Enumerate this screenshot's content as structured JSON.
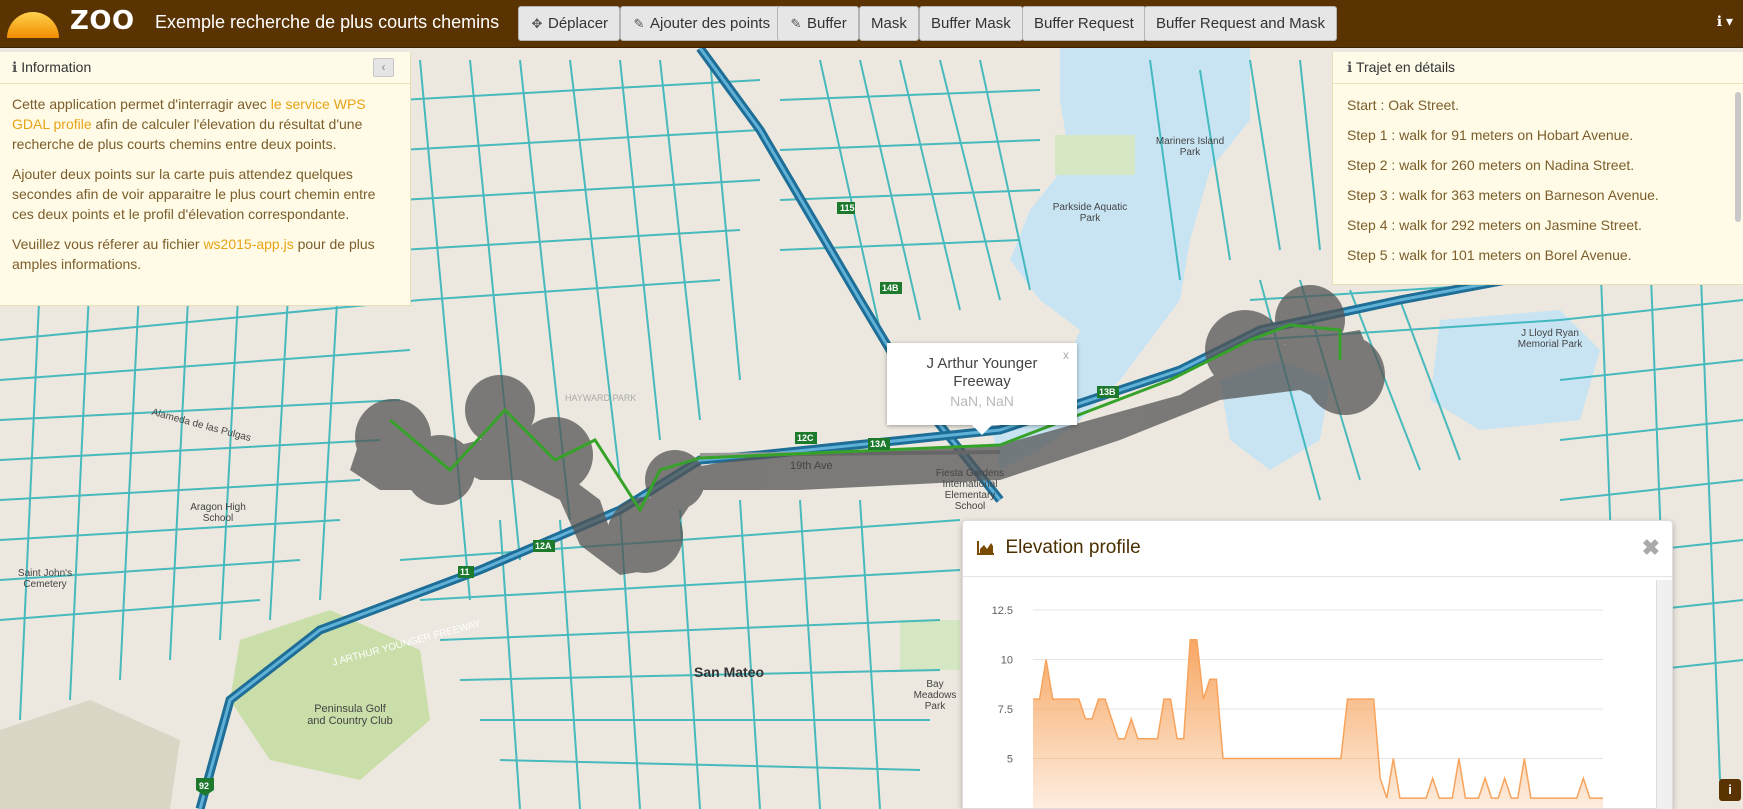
{
  "navbar": {
    "brand": "ZOO",
    "title": "Exemple recherche de plus courts chemins",
    "buttons": [
      {
        "icon": "move-icon",
        "glyph": "✥",
        "label": "Déplacer"
      },
      {
        "icon": "pencil-icon",
        "glyph": "✎",
        "label": "Ajouter des points"
      },
      {
        "icon": "pencil-icon",
        "glyph": "✎",
        "label": "Buffer"
      },
      {
        "icon": "",
        "glyph": "",
        "label": "Mask"
      },
      {
        "icon": "",
        "glyph": "",
        "label": "Buffer Mask"
      },
      {
        "icon": "",
        "glyph": "",
        "label": "Buffer Request"
      },
      {
        "icon": "",
        "glyph": "",
        "label": "Buffer Request and Mask"
      }
    ],
    "info_glyph": "ℹ ▾"
  },
  "info_panel": {
    "title": "Information",
    "collapse_glyph": "‹",
    "p1_before": "Cette application permet d'interragir avec ",
    "p1_link": "le service WPS GDAL profile",
    "p1_after": " afin de calculer l'élevation du résultat d'une recherche de plus courts chemins entre deux points.",
    "p2": "Ajouter deux points sur la carte puis attendez quelques secondes afin de voir apparaitre le plus court chemin entre ces deux points et le profil d'élevation correspondante.",
    "p3_before": "Veuillez vous réferer au fichier ",
    "p3_link": "ws2015-app.js",
    "p3_after": " pour de plus amples informations."
  },
  "route_panel": {
    "title": "Trajet en détails",
    "steps": [
      "Start : Oak Street.",
      "Step 1 : walk for 91 meters on Hobart Avenue.",
      "Step 2 : walk for 260 meters on Nadina Street.",
      "Step 3 : walk for 363 meters on Barneson Avenue.",
      "Step 4 : walk for 292 meters on Jasmine Street.",
      "Step 5 : walk for 101 meters on Borel Avenue."
    ]
  },
  "popup": {
    "title": "J Arthur Younger Freeway",
    "coords": "NaN, NaN",
    "close": "x"
  },
  "map_labels": [
    {
      "text": "San Mateo"
    },
    {
      "text": "Peninsula Golf and Country Club"
    },
    {
      "text": "Aragon High School"
    },
    {
      "text": "Mariners Island Park"
    },
    {
      "text": "Parkside Aquatic Park"
    },
    {
      "text": "J Lloyd Ryan Memorial Park"
    },
    {
      "text": "Bay Meadows Park"
    },
    {
      "text": "Fiesta Gardens International Elementary School"
    },
    {
      "text": "19th Ave"
    },
    {
      "text": "Alameda de las Pulgas"
    },
    {
      "text": "J ARTHUR YOUNGER FREEWAY"
    },
    {
      "text": "HAYWARD PARK"
    },
    {
      "text": "Saint John's Cemetery"
    }
  ],
  "elevation": {
    "title": "Elevation profile",
    "icon": "area-chart-icon",
    "close": "✖",
    "chart_data": {
      "type": "area",
      "title": "",
      "xlabel": "",
      "ylabel": "",
      "ylim": [
        2.5,
        12.5
      ],
      "yticks": [
        "12.5",
        "10",
        "7.5",
        "5"
      ],
      "ytick_values": [
        12.5,
        10,
        7.5,
        5
      ],
      "color": "#f7a35c",
      "values": [
        8,
        8,
        10,
        8,
        8,
        8,
        8,
        8,
        7,
        7,
        8,
        8,
        7,
        6,
        6,
        7,
        6,
        6,
        6,
        6,
        8,
        8,
        6,
        6,
        11,
        11,
        8,
        9,
        9,
        5,
        5,
        5,
        5,
        5,
        5,
        5,
        5,
        5,
        5,
        5,
        5,
        5,
        5,
        5,
        5,
        5,
        5,
        5,
        8,
        8,
        8,
        8,
        8,
        4,
        3,
        5,
        3,
        3,
        3,
        3,
        3,
        4,
        3,
        3,
        3,
        5,
        3,
        3,
        3,
        4,
        3,
        3,
        4,
        3,
        3,
        5,
        3,
        3,
        3,
        3,
        3,
        3,
        3,
        3,
        4,
        3,
        3,
        3
      ]
    }
  },
  "attribution": "i",
  "colors": {
    "navbar": "#5a3302",
    "accent": "#e8a317",
    "route": "#37a22a",
    "buffer": "#555555",
    "streets": "#2cb1b6",
    "water": "#c8e4f3",
    "highway": "#1e6e97"
  }
}
